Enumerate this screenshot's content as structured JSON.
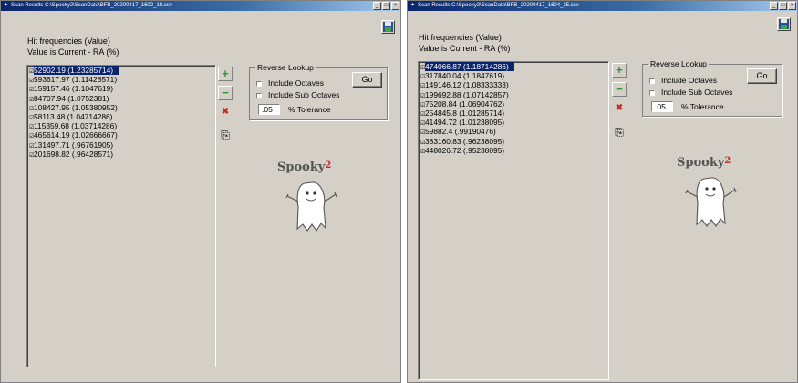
{
  "windows": [
    {
      "title": "Scan Results C:\\Spooky2\\ScanData\\BFB_20200417_1602_18.csv",
      "controls": [
        "_",
        "□",
        "×"
      ],
      "header_line1": "Hit frequencies (Value)",
      "header_line2": "Value is Current - RA (%)",
      "items": [
        "52902.19  (1.23285714)",
        "593617.97  (1.11428571)",
        "159157.46  (1.1047619)",
        "84707.94  (1.0752381)",
        "108427.95  (1.05380952)",
        "58113.48  (1.04714286)",
        "115359.68  (1.03714286)",
        "465614.19  (1.02666667)",
        "131497.71  (.96761905)",
        "201698.82  (.96428571)"
      ],
      "tools": {
        "add": "+",
        "remove": "−",
        "delete": "✖",
        "copy": "⎘"
      },
      "reverse_lookup": {
        "title": "Reverse Lookup",
        "include_octaves": "Include Octaves",
        "include_sub_octaves": "Include Sub Octaves",
        "tolerance_value": ".05",
        "tolerance_label": "% Tolerance",
        "go_label": "Go"
      },
      "logo": {
        "name": "Spooky",
        "suffix": "2"
      }
    },
    {
      "title": "Scan Results C:\\Spooky2\\ScanData\\BFB_20200417_1604_25.csv",
      "controls": [
        "_",
        "□",
        "×"
      ],
      "header_line1": "Hit frequencies (Value)",
      "header_line2": "Value is Current - RA (%)",
      "items": [
        "474066.87  (1.18714286)",
        "317840.04  (1.1847619)",
        "149146.12  (1.08333333)",
        "199692.88  (1.07142857)",
        "75208.84  (1.06904762)",
        "254845.8  (1.01285714)",
        "41494.72  (1.01238095)",
        "59882.4  (.99190476)",
        "383160.83  (.96238095)",
        "448026.72  (.95238095)"
      ],
      "tools": {
        "add": "+",
        "remove": "−",
        "delete": "✖",
        "copy": "⎘"
      },
      "reverse_lookup": {
        "title": "Reverse Lookup",
        "include_octaves": "Include Octaves",
        "include_sub_octaves": "Include Sub Octaves",
        "tolerance_value": ".05",
        "tolerance_label": "% Tolerance",
        "go_label": "Go"
      },
      "logo": {
        "name": "Spooky",
        "suffix": "2"
      }
    }
  ],
  "colors": {
    "selection": "#0a246a",
    "face": "#d4d0c8",
    "add_green": "#2e9b2e",
    "delete_red": "#c0302a"
  },
  "icons": {
    "save": "floppy-disk-icon",
    "ghost": "ghost-mascot-icon"
  }
}
